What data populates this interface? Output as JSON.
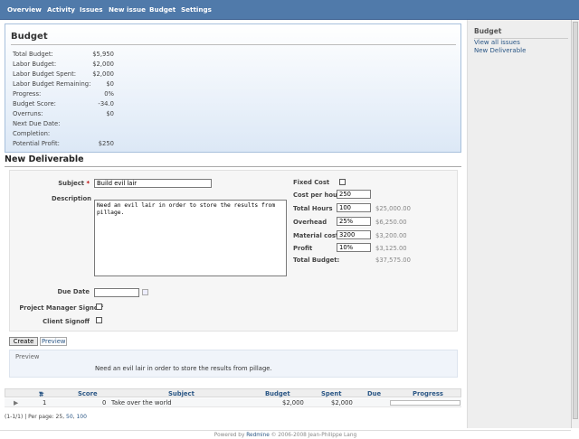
{
  "nav": [
    "Overview",
    "Activity",
    "Issues",
    "New issue",
    "Budget",
    "Settings"
  ],
  "sidebar": {
    "title": "Budget",
    "links": [
      "View all issues",
      "New Deliverable"
    ]
  },
  "budget": {
    "title": "Budget",
    "rows": [
      {
        "label": "Total Budget:",
        "value": "$5,950"
      },
      {
        "label": "Labor Budget:",
        "value": "$2,000"
      },
      {
        "label": "Labor Budget Spent:",
        "value": "$2,000"
      },
      {
        "label": "Labor Budget Remaining:",
        "value": "$0"
      },
      {
        "label": "Progress:",
        "value": "0%"
      },
      {
        "label": "Budget Score:",
        "value": "-34.0"
      },
      {
        "label": "Overruns:",
        "value": "$0"
      },
      {
        "label": "Next Due Date:",
        "value": ""
      },
      {
        "label": "Completion:",
        "value": ""
      },
      {
        "label": "Potential Profit:",
        "value": "$250"
      }
    ]
  },
  "form": {
    "heading": "New Deliverable",
    "subject_label": "Subject",
    "required_mark": "*",
    "subject_value": "Build evil lair",
    "description_label": "Description",
    "description_value": "Need an evil lair in order to store the results from pillage.",
    "due_date_label": "Due Date",
    "due_date_value": "",
    "pm_signoff_label": "Project Manager Signoff",
    "client_signoff_label": "Client Signoff",
    "fixed_cost_label": "Fixed Cost",
    "cost_per_hour_label": "Cost per hour",
    "cost_per_hour_value": "250",
    "total_hours_label": "Total Hours",
    "total_hours_value": "100",
    "total_hours_calc": "$25,000.00",
    "overhead_label": "Overhead",
    "overhead_value": "25%",
    "overhead_calc": "$6,250.00",
    "material_label": "Material costs",
    "material_value": "3200",
    "material_calc": "$3,200.00",
    "profit_label": "Profit",
    "profit_value": "10%",
    "profit_calc": "$3,125.00",
    "total_budget_label": "Total Budget:",
    "total_budget_calc": "$37,575.00",
    "create_label": "Create",
    "preview_link": "Preview"
  },
  "preview": {
    "legend": "Preview",
    "text": "Need an evil lair in order to store the results from pillage."
  },
  "table": {
    "headers": {
      "num": "#",
      "score": "Score",
      "subject": "Subject",
      "budget": "Budget",
      "spent": "Spent",
      "due": "Due",
      "progress": "Progress"
    },
    "rows": [
      {
        "num": "1",
        "score": "0",
        "subject": "Take over the world",
        "budget": "$2,000",
        "spent": "$2,000",
        "due": "",
        "progress": 0
      }
    ]
  },
  "pagination": {
    "summary": "(1-1/1) | Per page: ",
    "current": "25",
    "sep1": ", ",
    "opt2": "50",
    "sep2": ", ",
    "opt3": "100"
  },
  "footer": {
    "prefix": "Powered by ",
    "link": "Redmine",
    "suffix": " © 2006-2008 Jean-Philippe Lang"
  }
}
